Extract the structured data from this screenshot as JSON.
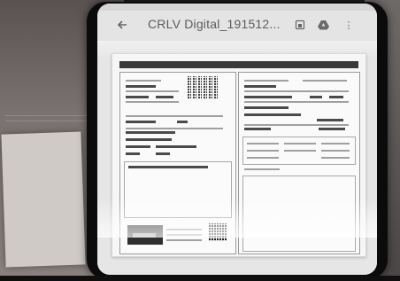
{
  "app": {
    "document_title": "CRLV Digital_191512...",
    "back_icon": "arrow-left-icon",
    "actions": [
      {
        "icon": "save-to-device-icon"
      },
      {
        "icon": "google-drive-icon"
      },
      {
        "icon": "more-vertical-icon"
      }
    ]
  }
}
